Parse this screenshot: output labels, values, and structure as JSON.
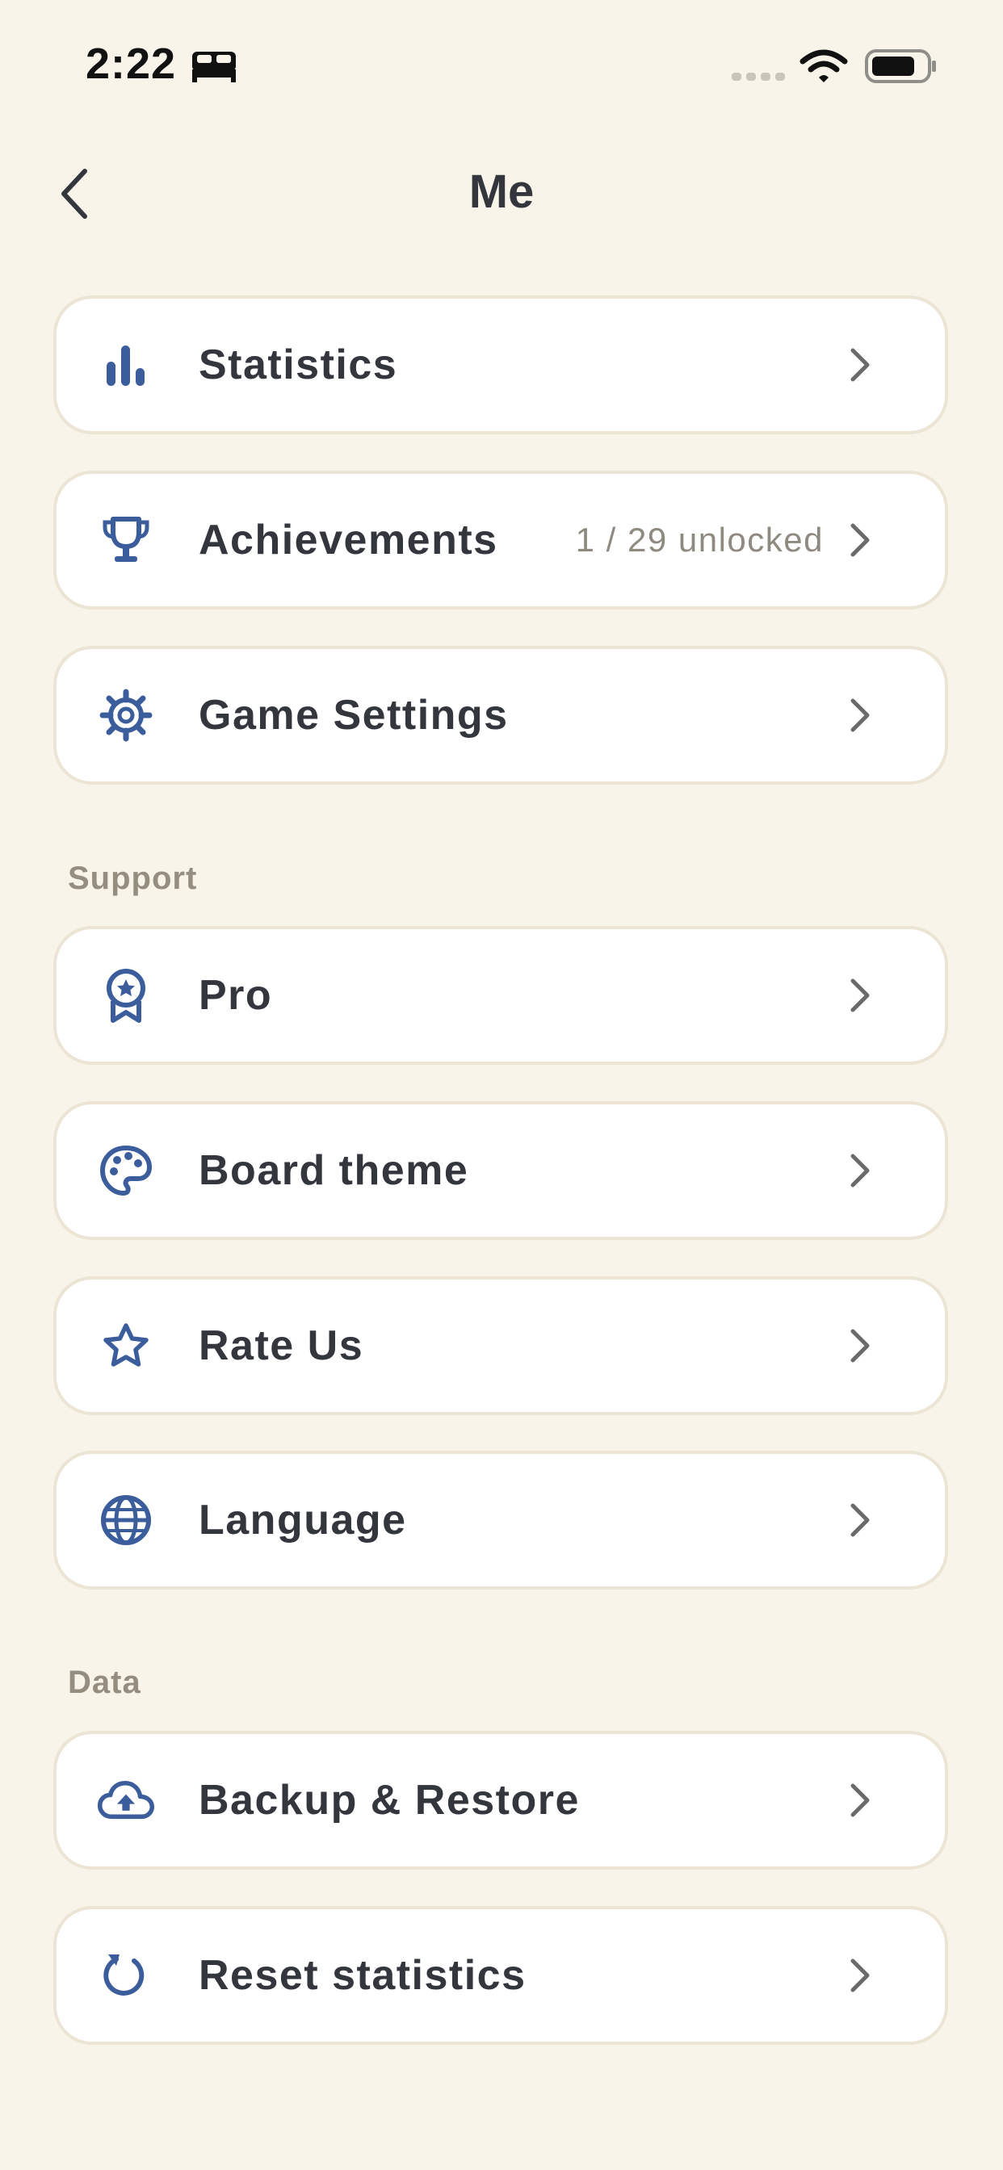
{
  "status_bar": {
    "time": "2:22",
    "icons": [
      "bed-icon",
      "signal-icon",
      "wifi-icon",
      "battery-icon"
    ]
  },
  "nav": {
    "back_icon": "chevron-left-icon",
    "title": "Me"
  },
  "colors": {
    "background": "#f8f4ea",
    "card": "#ffffff",
    "card_border": "#ece4d4",
    "accent_icon": "#3c5d9c",
    "text": "#33363d",
    "muted": "#958e80"
  },
  "main_items": [
    {
      "label": "Statistics",
      "icon": "bar-chart-icon",
      "detail": ""
    },
    {
      "label": "Achievements",
      "icon": "trophy-icon",
      "detail": "1 / 29 unlocked"
    },
    {
      "label": "Game Settings",
      "icon": "gear-icon",
      "detail": ""
    }
  ],
  "support": {
    "heading": "Support",
    "items": [
      {
        "label": "Pro",
        "icon": "award-badge-icon"
      },
      {
        "label": "Board theme",
        "icon": "palette-icon"
      },
      {
        "label": "Rate Us",
        "icon": "star-icon"
      },
      {
        "label": "Language",
        "icon": "globe-icon"
      }
    ]
  },
  "data_section": {
    "heading": "Data",
    "items": [
      {
        "label": "Backup & Restore",
        "icon": "cloud-upload-icon"
      },
      {
        "label": "Reset statistics",
        "icon": "refresh-icon"
      }
    ]
  }
}
